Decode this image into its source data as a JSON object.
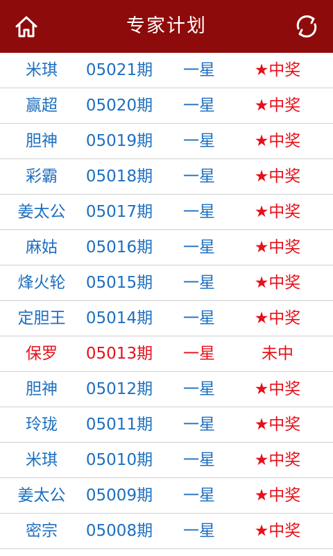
{
  "header": {
    "title": "专家计划"
  },
  "colors": {
    "header_bg": "#8e0b0b",
    "blue_text": "#1d6fc0",
    "red_text": "#e6101a"
  },
  "icons": {
    "home": "home-icon",
    "refresh": "refresh-icon"
  },
  "rows": [
    {
      "name": "米琪",
      "issue": "05021期",
      "type": "一星",
      "result": "★中奖",
      "hit": true
    },
    {
      "name": "赢超",
      "issue": "05020期",
      "type": "一星",
      "result": "★中奖",
      "hit": true
    },
    {
      "name": "胆神",
      "issue": "05019期",
      "type": "一星",
      "result": "★中奖",
      "hit": true
    },
    {
      "name": "彩霸",
      "issue": "05018期",
      "type": "一星",
      "result": "★中奖",
      "hit": true
    },
    {
      "name": "姜太公",
      "issue": "05017期",
      "type": "一星",
      "result": "★中奖",
      "hit": true
    },
    {
      "name": "麻姑",
      "issue": "05016期",
      "type": "一星",
      "result": "★中奖",
      "hit": true
    },
    {
      "name": "烽火轮",
      "issue": "05015期",
      "type": "一星",
      "result": "★中奖",
      "hit": true
    },
    {
      "name": "定胆王",
      "issue": "05014期",
      "type": "一星",
      "result": "★中奖",
      "hit": true
    },
    {
      "name": "保罗",
      "issue": "05013期",
      "type": "一星",
      "result": "未中",
      "hit": false
    },
    {
      "name": "胆神",
      "issue": "05012期",
      "type": "一星",
      "result": "★中奖",
      "hit": true
    },
    {
      "name": "玲珑",
      "issue": "05011期",
      "type": "一星",
      "result": "★中奖",
      "hit": true
    },
    {
      "name": "米琪",
      "issue": "05010期",
      "type": "一星",
      "result": "★中奖",
      "hit": true
    },
    {
      "name": "姜太公",
      "issue": "05009期",
      "type": "一星",
      "result": "★中奖",
      "hit": true
    },
    {
      "name": "密宗",
      "issue": "05008期",
      "type": "一星",
      "result": "★中奖",
      "hit": true
    }
  ]
}
